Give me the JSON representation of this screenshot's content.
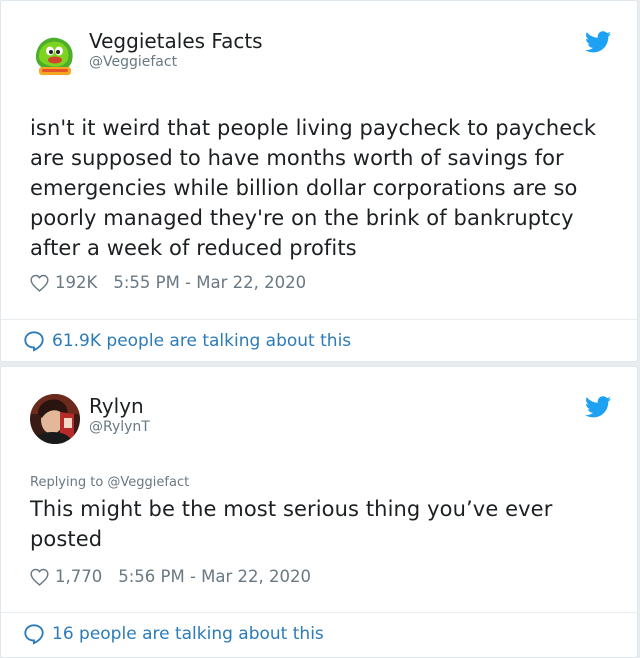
{
  "tweets": [
    {
      "author_name": "Veggietales Facts",
      "author_handle": "@Veggiefact",
      "text": "isn't it weird that people living paycheck to paycheck are supposed to have months worth of savings for emergencies while billion dollar corporations are so poorly managed they're on the brink of bankruptcy after a week of reduced profits",
      "likes": "192K",
      "timestamp": "5:55 PM - Mar 22, 2020",
      "talking": "61.9K people are talking about this",
      "icons": [
        "veggietales-logo-avatar",
        "twitter-bird-icon",
        "heart-icon",
        "speech-bubble-icon"
      ]
    },
    {
      "author_name": "Rylyn",
      "author_handle": "@RylynT",
      "replying_to": "Replying to @Veggiefact",
      "text": "This might be the most serious thing you’ve ever posted",
      "likes": "1,770",
      "timestamp": "5:56 PM - Mar 22, 2020",
      "talking": "16 people are talking about this",
      "icons": [
        "profile-photo-avatar",
        "twitter-bird-icon",
        "heart-icon",
        "speech-bubble-icon"
      ]
    }
  ],
  "colors": {
    "text": "#1c2022",
    "secondary": "#697882",
    "link": "#2b7bb9",
    "twitter_blue": "#1da1f2",
    "background": "#e9ecef"
  }
}
